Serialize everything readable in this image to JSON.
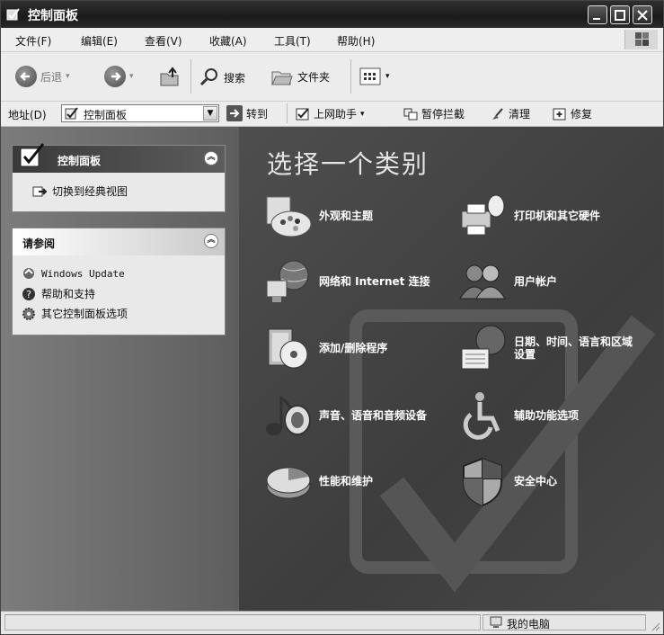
{
  "window": {
    "title": "控制面板"
  },
  "menu": [
    "文件(F)",
    "编辑(E)",
    "查看(V)",
    "收藏(A)",
    "工具(T)",
    "帮助(H)"
  ],
  "toolbar": {
    "back": "后退",
    "search": "搜索",
    "folders": "文件夹"
  },
  "address": {
    "label": "地址(D)",
    "value": "控制面板",
    "go": "转到",
    "links": [
      {
        "label": "上网助手",
        "icon": "checkbox-icon"
      },
      {
        "label": "暂停拦截",
        "icon": "block-icon"
      },
      {
        "label": "清理",
        "icon": "broom-icon"
      },
      {
        "label": "修复",
        "icon": "repair-icon"
      }
    ]
  },
  "sidebar": {
    "panel1": {
      "title": "控制面板",
      "link": "切换到经典视图"
    },
    "panel2": {
      "title": "请参阅",
      "items": [
        {
          "label": "Windows Update",
          "icon": "update-icon"
        },
        {
          "label": "帮助和支持",
          "icon": "help-icon"
        },
        {
          "label": "其它控制面板选项",
          "icon": "gear-icon"
        }
      ]
    }
  },
  "main": {
    "heading": "选择一个类别",
    "categories": [
      {
        "label": "外观和主题",
        "icon": "appearance-icon"
      },
      {
        "label": "打印机和其它硬件",
        "icon": "printer-icon"
      },
      {
        "label": "网络和 Internet 连接",
        "icon": "network-icon"
      },
      {
        "label": "用户帐户",
        "icon": "users-icon"
      },
      {
        "label": "添加/删除程序",
        "icon": "programs-icon"
      },
      {
        "label": "日期、时间、语言和区域设置",
        "icon": "datetime-icon"
      },
      {
        "label": "声音、语音和音频设备",
        "icon": "sound-icon"
      },
      {
        "label": "辅助功能选项",
        "icon": "accessibility-icon"
      },
      {
        "label": "性能和维护",
        "icon": "performance-icon"
      },
      {
        "label": "安全中心",
        "icon": "shield-icon"
      }
    ]
  },
  "status": {
    "location": "我的电脑"
  }
}
